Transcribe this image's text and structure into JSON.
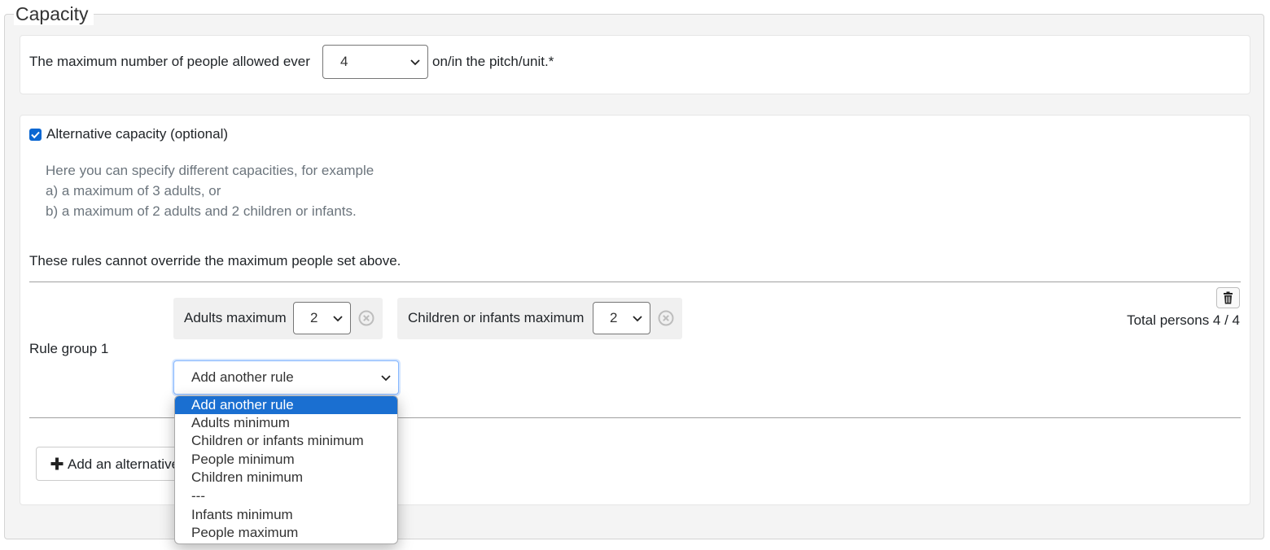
{
  "fieldset": {
    "legend": "Capacity"
  },
  "max_people": {
    "prefix": "The maximum number of people allowed ever",
    "selected": "4",
    "suffix": "on/in the pitch/unit.*"
  },
  "alt_capacity": {
    "checkbox_label": "Alternative capacity (optional)",
    "checked": true,
    "help_lines": [
      "Here you can specify different capacities, for example",
      "a) a maximum of 3 adults, or",
      "b) a maximum of 2 adults and 2 children or infants."
    ],
    "note": "These rules cannot override the maximum people set above."
  },
  "rule_group": {
    "label": "Rule group 1",
    "rules": [
      {
        "label": "Adults maximum",
        "value": "2"
      },
      {
        "label": "Children or infants maximum",
        "value": "2"
      }
    ],
    "total": "Total persons 4 / 4",
    "add_rule_select": "Add another rule"
  },
  "dropdown_options": [
    "Add another rule",
    "Adults minimum",
    "Children or infants minimum",
    "People minimum",
    "Children minimum",
    "---",
    "Infants minimum",
    "People maximum"
  ],
  "add_alternative_button": "Add an alternative",
  "icons": {
    "chevron": "chevron-down-icon",
    "remove": "remove-circle-icon",
    "trash": "trash-icon",
    "plus": "plus-icon",
    "check": "checkmark-icon"
  },
  "colors": {
    "accent": "#1a6fd1",
    "muted_text": "#6c757d"
  }
}
